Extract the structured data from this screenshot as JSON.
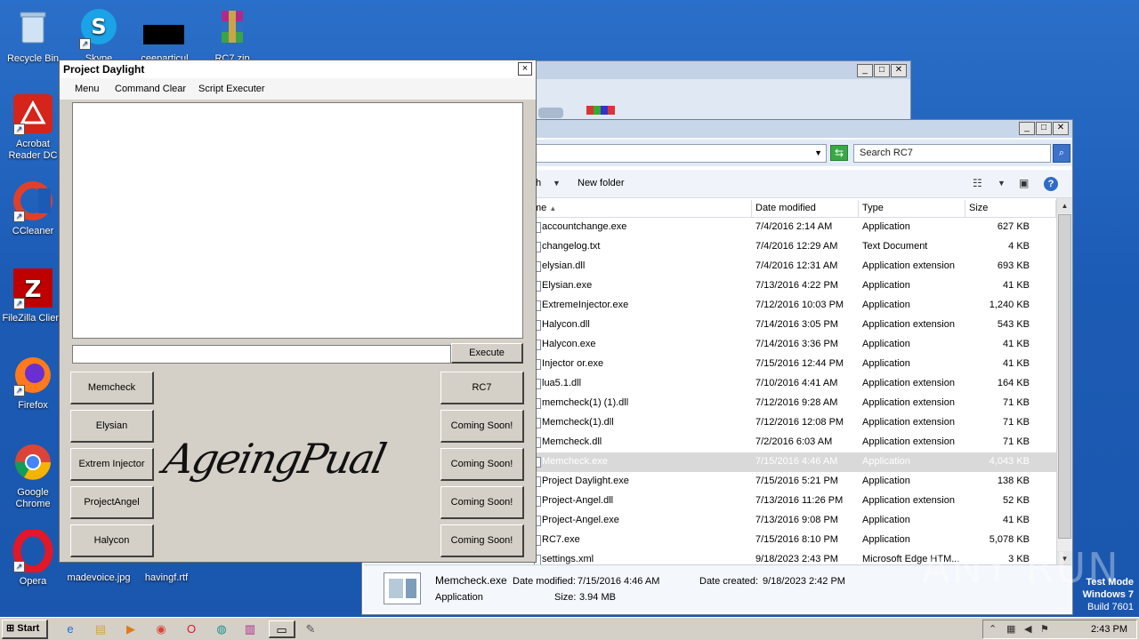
{
  "desktop": {
    "icons": [
      {
        "label": "Recycle Bin"
      },
      {
        "label": "Skype"
      },
      {
        "label": "ceeparticul"
      },
      {
        "label": "RC7.zip"
      },
      {
        "label": "Acrobat Reader DC"
      },
      {
        "label": "CCleaner"
      },
      {
        "label": "FileZilla Client"
      },
      {
        "label": "Firefox"
      },
      {
        "label": "Google Chrome"
      },
      {
        "label": "Opera"
      },
      {
        "label": "madevoice.jpg"
      },
      {
        "label": "havingf.rtf"
      }
    ]
  },
  "daylight": {
    "title": "Project Daylight",
    "close": "×",
    "menu": [
      "Menu",
      "Command Clear",
      "Script Executer"
    ],
    "execute_label": "Execute",
    "left_buttons": [
      "Memcheck",
      "Elysian",
      "Extrem Injector",
      "ProjectAngel",
      "Halycon"
    ],
    "right_buttons": [
      "RC7",
      "Coming Soon!",
      "Coming Soon!",
      "Coming Soon!",
      "Coming Soon!"
    ],
    "logo_text": "AgeingPual"
  },
  "explorer": {
    "search_placeholder": "Search RC7",
    "toolbar": {
      "partial_label": "th",
      "new_folder": "New folder"
    },
    "columns": [
      "me",
      "Date modified",
      "Type",
      "Size"
    ],
    "files": [
      {
        "name": "accountchange.exe",
        "date": "7/4/2016 2:14 AM",
        "type": "Application",
        "size": "627 KB"
      },
      {
        "name": "changelog.txt",
        "date": "7/4/2016 12:29 AM",
        "type": "Text Document",
        "size": "4 KB"
      },
      {
        "name": "elysian.dll",
        "date": "7/4/2016 12:31 AM",
        "type": "Application extension",
        "size": "693 KB"
      },
      {
        "name": "Elysian.exe",
        "date": "7/13/2016 4:22 PM",
        "type": "Application",
        "size": "41 KB"
      },
      {
        "name": "ExtremeInjector.exe",
        "date": "7/12/2016 10:03 PM",
        "type": "Application",
        "size": "1,240 KB"
      },
      {
        "name": "Halycon.dll",
        "date": "7/14/2016 3:05 PM",
        "type": "Application extension",
        "size": "543 KB"
      },
      {
        "name": "Halycon.exe",
        "date": "7/14/2016 3:36 PM",
        "type": "Application",
        "size": "41 KB"
      },
      {
        "name": "Injector or.exe",
        "date": "7/15/2016 12:44 PM",
        "type": "Application",
        "size": "41 KB"
      },
      {
        "name": "lua5.1.dll",
        "date": "7/10/2016 4:41 AM",
        "type": "Application extension",
        "size": "164 KB"
      },
      {
        "name": "memcheck(1) (1).dll",
        "date": "7/12/2016 9:28 AM",
        "type": "Application extension",
        "size": "71 KB"
      },
      {
        "name": "Memcheck(1).dll",
        "date": "7/12/2016 12:08 PM",
        "type": "Application extension",
        "size": "71 KB"
      },
      {
        "name": "Memcheck.dll",
        "date": "7/2/2016 6:03 AM",
        "type": "Application extension",
        "size": "71 KB"
      },
      {
        "name": "Memcheck.exe",
        "date": "7/15/2016 4:46 AM",
        "type": "Application",
        "size": "4,043 KB"
      },
      {
        "name": "Project Daylight.exe",
        "date": "7/15/2016 5:21 PM",
        "type": "Application",
        "size": "138 KB"
      },
      {
        "name": "Project-Angel.dll",
        "date": "7/13/2016 11:26 PM",
        "type": "Application extension",
        "size": "52 KB"
      },
      {
        "name": "Project-Angel.exe",
        "date": "7/13/2016 9:08 PM",
        "type": "Application",
        "size": "41 KB"
      },
      {
        "name": "RC7.exe",
        "date": "7/15/2016 8:10 PM",
        "type": "Application",
        "size": "5,078 KB"
      },
      {
        "name": "settings.xml",
        "date": "9/18/2023 2:43 PM",
        "type": "Microsoft Edge HTM...",
        "size": "3 KB"
      }
    ],
    "selected_index": 12,
    "details": {
      "name": "Memcheck.exe",
      "modified_label": "Date modified:",
      "modified": "7/15/2016 4:46 AM",
      "created_label": "Date created:",
      "created": "9/18/2023 2:42 PM",
      "type": "Application",
      "size_label": "Size:",
      "size": "3.94 MB"
    }
  },
  "watermark": "ANY RUN",
  "test_mode": {
    "line1": "Test Mode",
    "line2": "Windows 7",
    "line3": "Build 7601"
  },
  "taskbar": {
    "start_label": "Start",
    "clock": "2:43 PM"
  },
  "colors": {
    "desktop": "#1c5bb5",
    "classic_gray": "#d4d0c8"
  }
}
